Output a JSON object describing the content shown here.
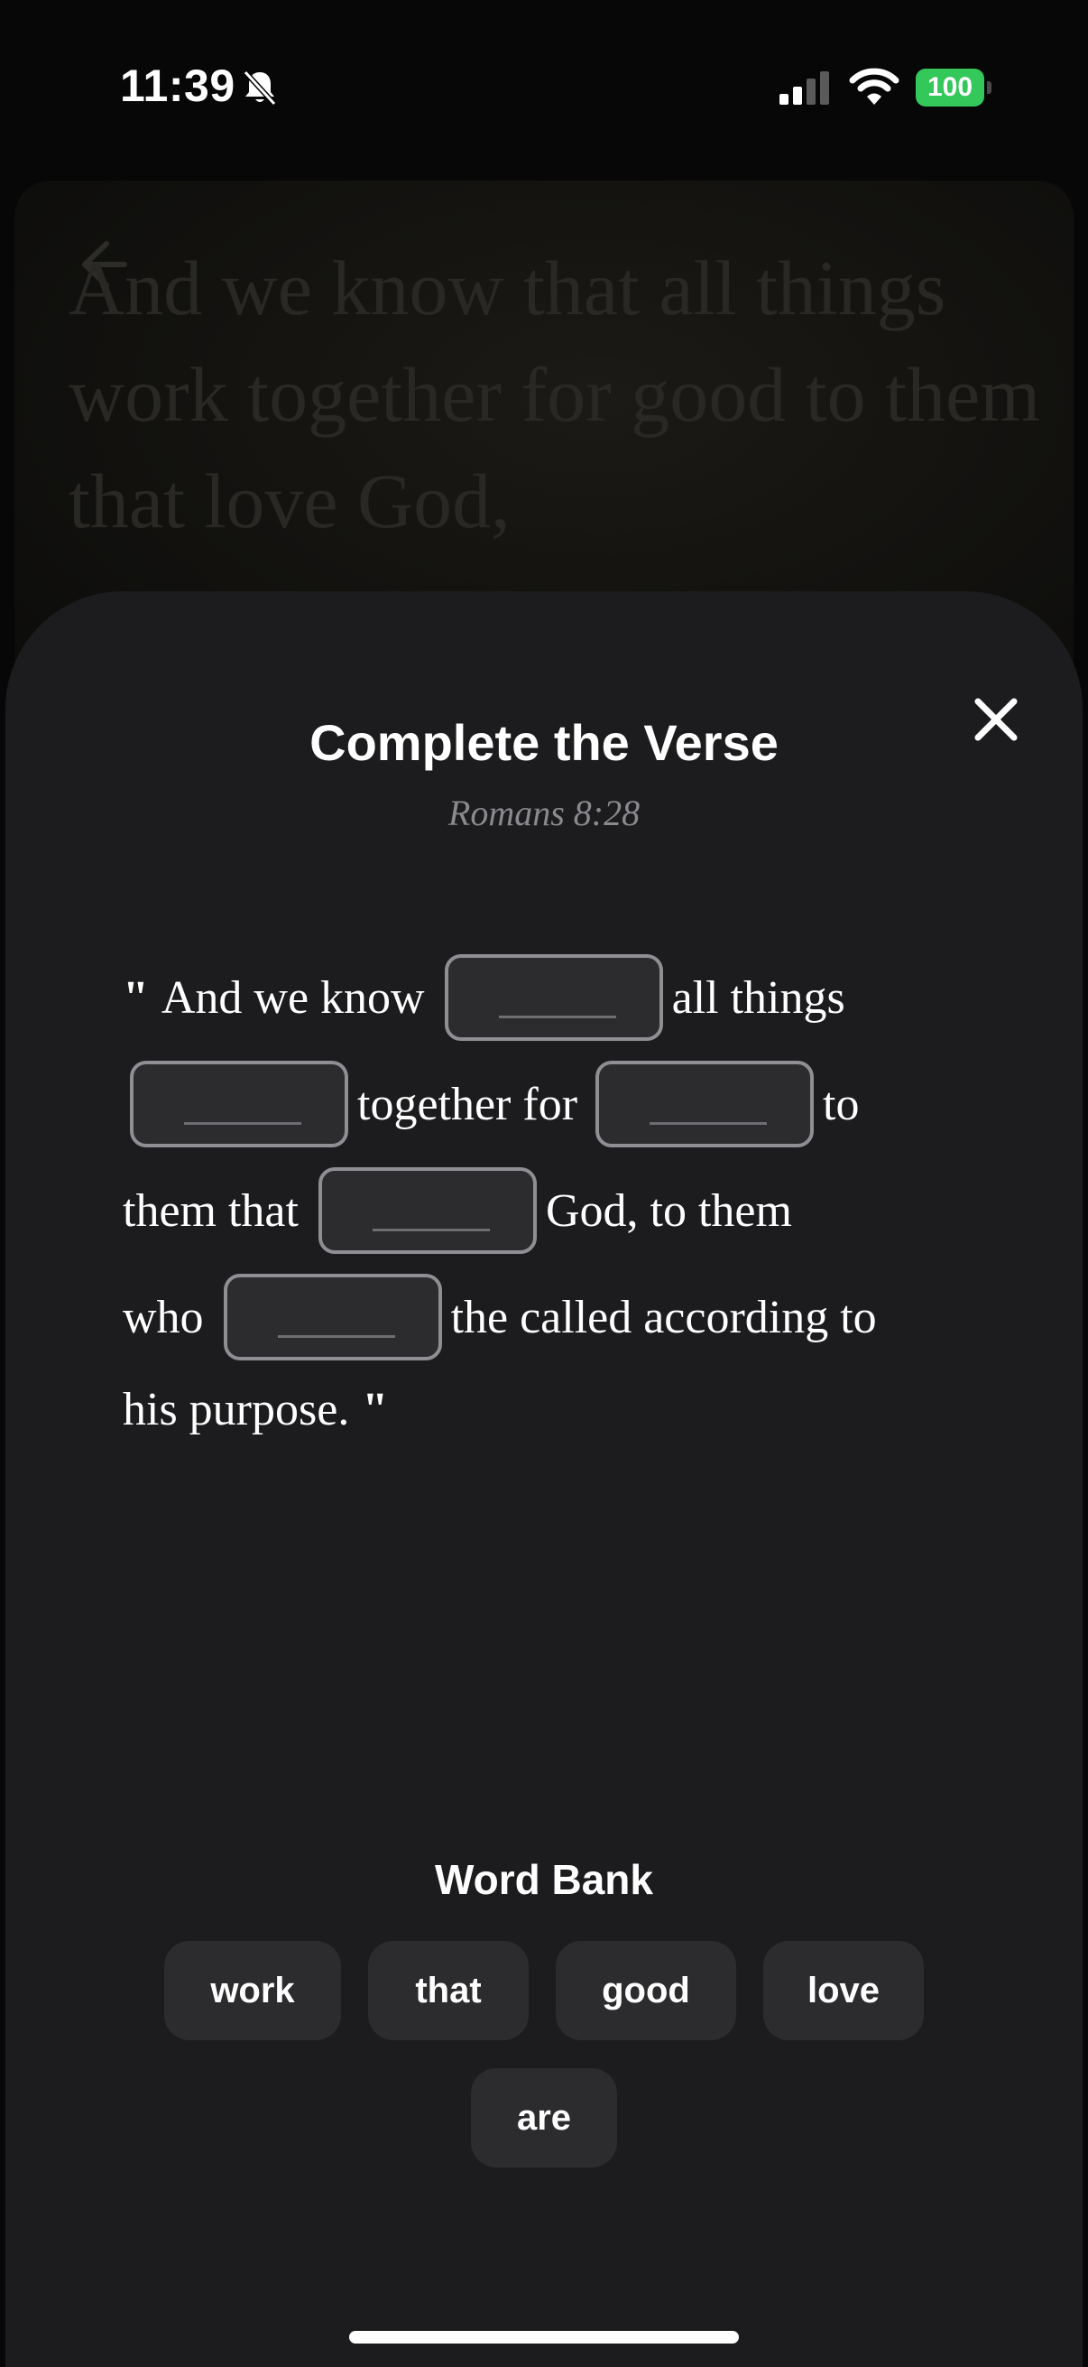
{
  "status_bar": {
    "time": "11:39",
    "battery": "100"
  },
  "background": {
    "verse_preview": "And we know that all things work together for good to them that love God,"
  },
  "sheet": {
    "title": "Complete the Verse",
    "reference": "Romans 8:28",
    "verse": {
      "open_quote": "\"",
      "close_quote": "\"",
      "segments": [
        "And we know",
        "all things",
        "together for",
        "to",
        "them that",
        "God, to them",
        "who",
        "the called according to",
        "his purpose."
      ],
      "blank_placeholder": "_____"
    },
    "word_bank": {
      "title": "Word Bank",
      "words": [
        "work",
        "that",
        "good",
        "love",
        "are"
      ]
    }
  },
  "colors": {
    "sheet_bg": "#1c1c1e",
    "chip_bg": "#2c2c2e",
    "blank_border": "#8e8e93",
    "reference_text": "#8a8a8e",
    "battery_green": "#34c759"
  }
}
